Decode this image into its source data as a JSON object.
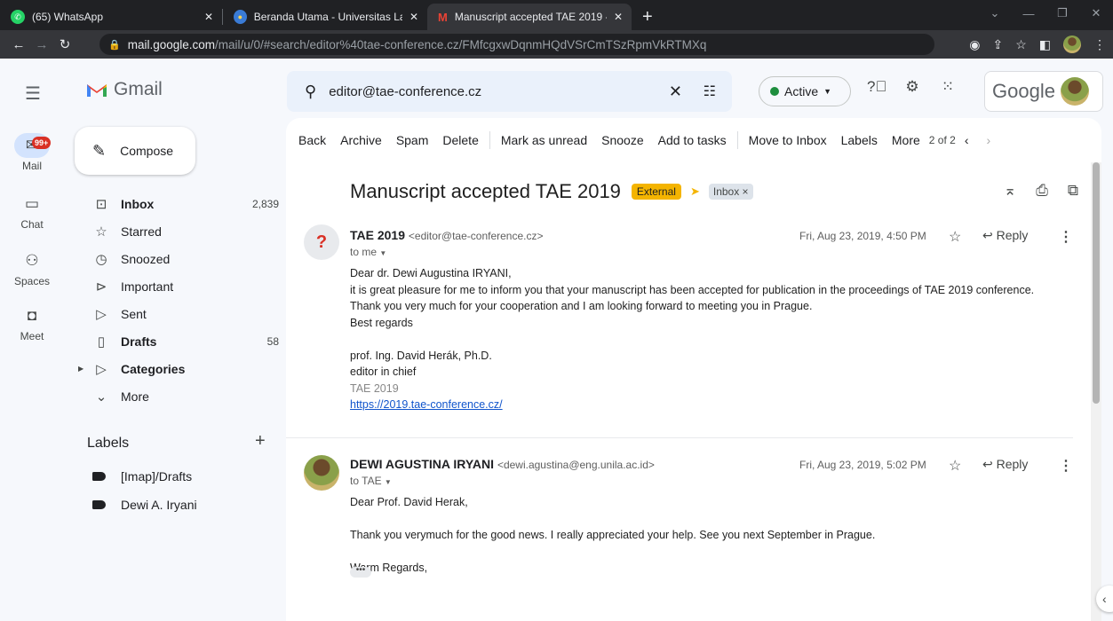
{
  "browser": {
    "tabs": [
      {
        "title": "(65) WhatsApp",
        "icon": "whatsapp-icon",
        "active": false
      },
      {
        "title": "Beranda Utama - Universitas Lam",
        "icon": "university-icon",
        "active": false
      },
      {
        "title": "Manuscript accepted TAE 2019 - ",
        "icon": "gmail-icon",
        "active": true
      }
    ],
    "new_tab": "+",
    "url_host": "mail.google.com",
    "url_path": "/mail/u/0/#search/editor%40tae-conference.cz/FMfcgxwDqnmHQdVSrCmTSzRpmVkRTMXq"
  },
  "header": {
    "app_name": "Gmail",
    "search_value": "editor@tae-conference.cz",
    "status": "Active",
    "brand": "Google"
  },
  "rail": {
    "badge": "99+",
    "items": [
      "Mail",
      "Chat",
      "Spaces",
      "Meet"
    ]
  },
  "sidebar": {
    "compose": "Compose",
    "nav": [
      {
        "label": "Inbox",
        "count": "2,839",
        "bold": true
      },
      {
        "label": "Starred",
        "count": ""
      },
      {
        "label": "Snoozed",
        "count": ""
      },
      {
        "label": "Important",
        "count": ""
      },
      {
        "label": "Sent",
        "count": ""
      },
      {
        "label": "Drafts",
        "count": "58",
        "bold": true
      },
      {
        "label": "Categories",
        "count": "",
        "bold": true
      },
      {
        "label": "More",
        "count": ""
      }
    ],
    "labels_title": "Labels",
    "labels": [
      "[Imap]/Drafts",
      "Dewi A. Iryani"
    ]
  },
  "toolbar": {
    "actions": [
      "Back",
      "Archive",
      "Spam",
      "Delete",
      "Mark as unread",
      "Snooze",
      "Add to tasks",
      "Move to Inbox",
      "Labels",
      "More"
    ],
    "pagination": "2 of 2"
  },
  "thread": {
    "subject": "Manuscript accepted TAE 2019",
    "external_chip": "External",
    "inbox_chip": "Inbox ×",
    "messages": [
      {
        "sender": "TAE 2019",
        "email": "<editor@tae-conference.cz>",
        "to": "to me",
        "date": "Fri, Aug 23, 2019, 4:50 PM",
        "reply": "Reply",
        "body": [
          "Dear dr. Dewi Augustina IRYANI,",
          "it is great pleasure for me to inform you that your manuscript has been accepted for publication in the proceedings of TAE 2019 conference.",
          "Thank you very much for your cooperation and I am looking forward to meeting you in Prague.",
          "Best regards",
          "",
          "prof. Ing. David Herák, Ph.D.",
          "editor in chief"
        ],
        "sig_org": "TAE 2019",
        "sig_link": "https://2019.tae-conference.cz/"
      },
      {
        "sender": "DEWI AGUSTINA IRYANI",
        "email": "<dewi.agustina@eng.unila.ac.id>",
        "to": "to TAE",
        "date": "Fri, Aug 23, 2019, 5:02 PM",
        "reply": "Reply",
        "body": [
          "Dear Prof. David Herak,",
          "",
          "Thank you verymuch for the good news. I really appreciated your help. See you next September in Prague.",
          "",
          "Warm Regards,"
        ]
      }
    ]
  },
  "colors": {
    "accent": "#f4b400",
    "active_dot": "#1e8e3e",
    "badge": "#d93025",
    "link": "#1155cc"
  }
}
